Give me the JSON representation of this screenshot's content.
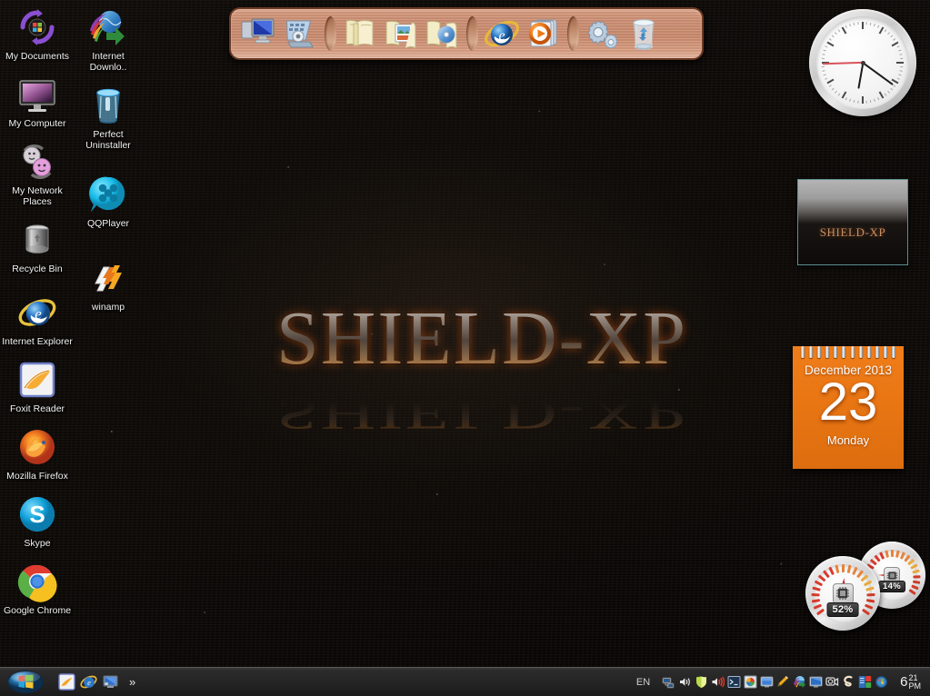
{
  "desktop": {
    "wallpaper_logo": "SHIELD-XP",
    "background_color": "#0a0706",
    "accent_color": "#e08a3a"
  },
  "desktop_icons": [
    {
      "label": "My Documents",
      "icon": "my-documents-icon"
    },
    {
      "label": "Internet Downlo..",
      "icon": "internet-download-manager-icon"
    },
    {
      "label": "My Computer",
      "icon": "my-computer-icon"
    },
    {
      "label": "Perfect Uninstaller",
      "icon": "perfect-uninstaller-icon"
    },
    {
      "label": "My Network Places",
      "icon": "my-network-places-icon"
    },
    {
      "label": "QQPlayer",
      "icon": "qqplayer-icon"
    },
    {
      "label": "Recycle Bin",
      "icon": "recycle-bin-icon"
    },
    {
      "label": "winamp",
      "icon": "winamp-icon"
    },
    {
      "label": "Internet Explorer",
      "icon": "internet-explorer-icon"
    },
    {
      "label": "Foxit Reader",
      "icon": "foxit-reader-icon"
    },
    {
      "label": "Mozilla Firefox",
      "icon": "mozilla-firefox-icon"
    },
    {
      "label": "Skype",
      "icon": "skype-icon"
    },
    {
      "label": "Google Chrome",
      "icon": "google-chrome-icon"
    }
  ],
  "dock": {
    "background_color": "#cd9277",
    "items": [
      {
        "type": "icon",
        "name": "my-computer-icon",
        "title": "My Computer"
      },
      {
        "type": "icon",
        "name": "control-panel-icon",
        "title": "Control Panel"
      },
      {
        "type": "separator",
        "name": "dock-separator"
      },
      {
        "type": "icon",
        "name": "documents-folder-icon",
        "title": "My Documents"
      },
      {
        "type": "icon",
        "name": "pictures-folder-icon",
        "title": "My Pictures"
      },
      {
        "type": "icon",
        "name": "music-folder-icon",
        "title": "My Music"
      },
      {
        "type": "separator",
        "name": "dock-separator"
      },
      {
        "type": "icon",
        "name": "internet-explorer-icon",
        "title": "Internet Explorer"
      },
      {
        "type": "icon",
        "name": "windows-media-player-icon",
        "title": "Windows Media Player"
      },
      {
        "type": "separator",
        "name": "dock-separator"
      },
      {
        "type": "icon",
        "name": "settings-gears-icon",
        "title": "Settings"
      },
      {
        "type": "icon",
        "name": "recycle-bin-icon",
        "title": "Recycle Bin"
      }
    ]
  },
  "clock_widget": {
    "name": "analog-clock",
    "hour_angle": 190,
    "minute_angle": 126,
    "second_angle": 268
  },
  "preview_panel": {
    "text": "SHIELD-XP",
    "border_color": "#5d8f91"
  },
  "calendar": {
    "month_year": "December 2013",
    "day_number": "23",
    "weekday": "Monday",
    "color": "#ef7d1a"
  },
  "gauges": [
    {
      "name": "cpu-gauge",
      "label": "52%",
      "value": 52,
      "icon": "cpu-chip-icon"
    },
    {
      "name": "ram-gauge",
      "label": "14%",
      "value": 14,
      "icon": "memory-chip-icon"
    }
  ],
  "taskbar": {
    "start_title": "Start",
    "quick_launch": [
      {
        "name": "foxit-reader-icon",
        "title": "Foxit Reader"
      },
      {
        "name": "internet-explorer-icon",
        "title": "Internet Explorer"
      },
      {
        "name": "show-desktop-icon",
        "title": "Show Desktop"
      }
    ],
    "overflow_chevron": "»",
    "tray": {
      "language": "EN",
      "icons": [
        {
          "name": "network-connection-icon",
          "title": "Local Area Connection"
        },
        {
          "name": "volume-speaker-icon",
          "title": "Volume"
        },
        {
          "name": "shield-green-icon",
          "title": "Security"
        },
        {
          "name": "speaker-mute-red-icon",
          "title": "Audio Mixer"
        },
        {
          "name": "console-window-icon",
          "title": "Console"
        },
        {
          "name": "colorful-app-icon",
          "title": "Utility"
        },
        {
          "name": "monitor-blue-icon",
          "title": "Display"
        },
        {
          "name": "pencil-orange-icon",
          "title": "Editor"
        },
        {
          "name": "internet-download-manager-icon",
          "title": "Internet Download Manager"
        },
        {
          "name": "screen-monitor-icon",
          "title": "Screen Tool"
        },
        {
          "name": "webcam-icon",
          "title": "Camera"
        },
        {
          "name": "skype-s-icon",
          "title": "Skype"
        },
        {
          "name": "office-apps-icon",
          "title": "Office"
        },
        {
          "name": "media-orb-icon",
          "title": "Media"
        }
      ],
      "clock": {
        "hour": "6",
        "minutes": "21",
        "meridiem": "PM"
      }
    }
  }
}
